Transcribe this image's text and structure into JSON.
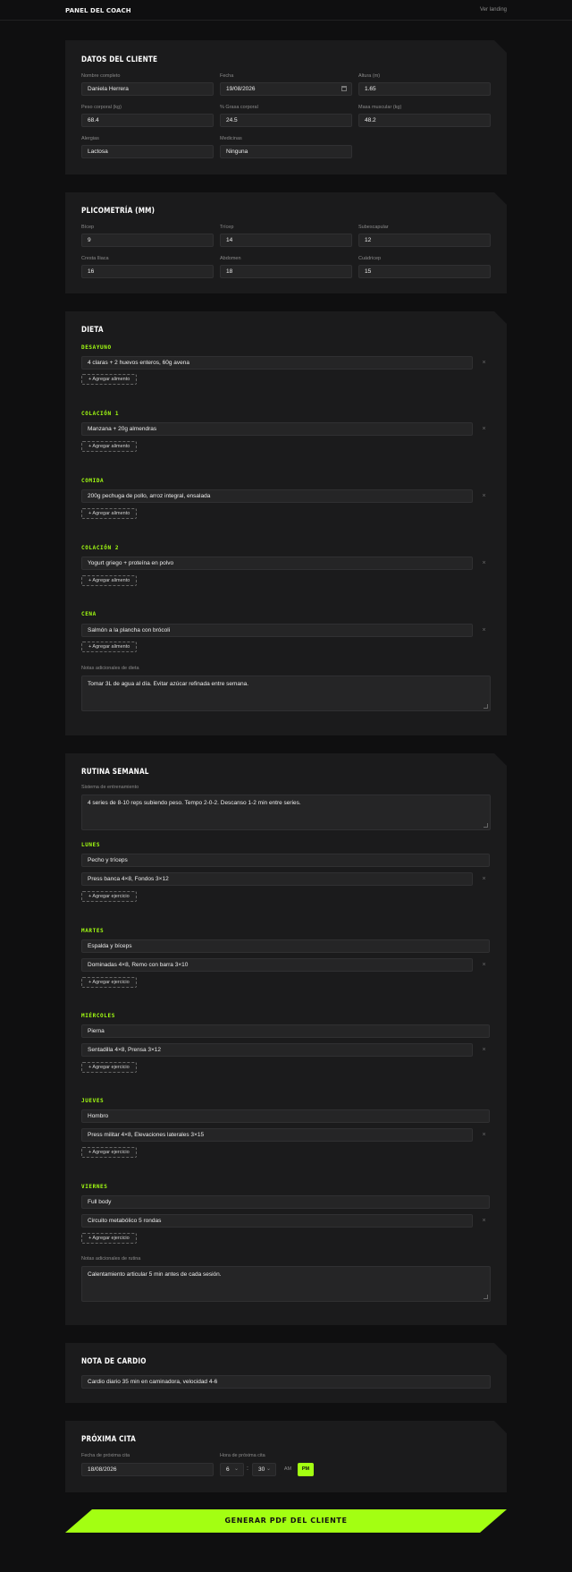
{
  "topbar": {
    "brand": "PANEL DEL COACH",
    "link": "Ver landing"
  },
  "client": {
    "title": "DATOS DEL CLIENTE",
    "name_label": "Nombre completo",
    "name": "Daniela Herrera",
    "date_label": "Fecha",
    "date": "19/08/2026",
    "height_label": "Altura (m)",
    "height": "1.65",
    "weight_label": "Peso corporal (kg)",
    "weight": "68.4",
    "fat_label": "% Grasa corporal",
    "fat": "24.5",
    "muscle_label": "Masa muscular (kg)",
    "muscle": "48.2",
    "allergies_label": "Alergias",
    "allergies": "Lactosa",
    "meds_label": "Medicinas",
    "meds": "Ninguna"
  },
  "plico": {
    "title": "PLICOMETRÍA (MM)",
    "bicep_label": "Bícep",
    "bicep": "9",
    "tricep_label": "Trícep",
    "tricep": "14",
    "subscap_label": "Subescapular",
    "subscap": "12",
    "cresta_label": "Cresta Iliaca",
    "cresta": "16",
    "abdomen_label": "Abdomen",
    "abdomen": "18",
    "cuad_label": "Cuádricep",
    "cuad": "15"
  },
  "diet": {
    "title": "DIETA",
    "add_label": "+ Agregar alimento",
    "meals": [
      {
        "name": "DESAYUNO",
        "item": "4 claras + 2 huevos enteros, 60g avena"
      },
      {
        "name": "COLACIÓN 1",
        "item": "Manzana + 20g almendras"
      },
      {
        "name": "COMIDA",
        "item": "200g pechuga de pollo, arroz integral, ensalada"
      },
      {
        "name": "COLACIÓN 2",
        "item": "Yogurt griego + proteína en polvo"
      },
      {
        "name": "CENA",
        "item": "Salmón a la plancha con brócoli"
      }
    ],
    "notes_label": "Notas adicionales de dieta",
    "notes": "Tomar 3L de agua al día. Evitar azúcar refinada entre semana."
  },
  "routine": {
    "title": "RUTINA SEMANAL",
    "system_label": "Sistema de entrenamiento",
    "system": "4 series de 8-10 reps subiendo peso. Tempo 2-0-2. Descanso 1-2 min entre series.",
    "add_label": "+ Agregar ejercicio",
    "days": [
      {
        "name": "LUNES",
        "focus": "Pecho y tríceps",
        "exercise": "Press banca 4×8, Fondos 3×12"
      },
      {
        "name": "MARTES",
        "focus": "Espalda y bíceps",
        "exercise": "Dominadas 4×8, Remo con barra 3×10"
      },
      {
        "name": "MIÉRCOLES",
        "focus": "Pierna",
        "exercise": "Sentadilla 4×8, Prensa 3×12"
      },
      {
        "name": "JUEVES",
        "focus": "Hombro",
        "exercise": "Press militar 4×8, Elevaciones laterales 3×15"
      },
      {
        "name": "VIERNES",
        "focus": "Full body",
        "exercise": "Circuito metabólico 5 rondas"
      }
    ],
    "notes_label": "Notas adicionales de rutina",
    "notes": "Calentamiento articular 5 min antes de cada sesión."
  },
  "cardio": {
    "title": "NOTA DE CARDIO",
    "note": "Cardio diario 35 min en caminadora, velocidad 4-6"
  },
  "appointment": {
    "title": "PRÓXIMA CITA",
    "date_label": "Fecha de próxima cita",
    "date": "18/08/2026",
    "time_label": "Hora de próxima cita",
    "hour": "6",
    "colon": ":",
    "minute": "30",
    "am": "AM",
    "pm": "PM"
  },
  "pdf_button": "GENERAR PDF DEL CLIENTE",
  "remove_symbol": "×",
  "chevron_symbol": "⌄"
}
